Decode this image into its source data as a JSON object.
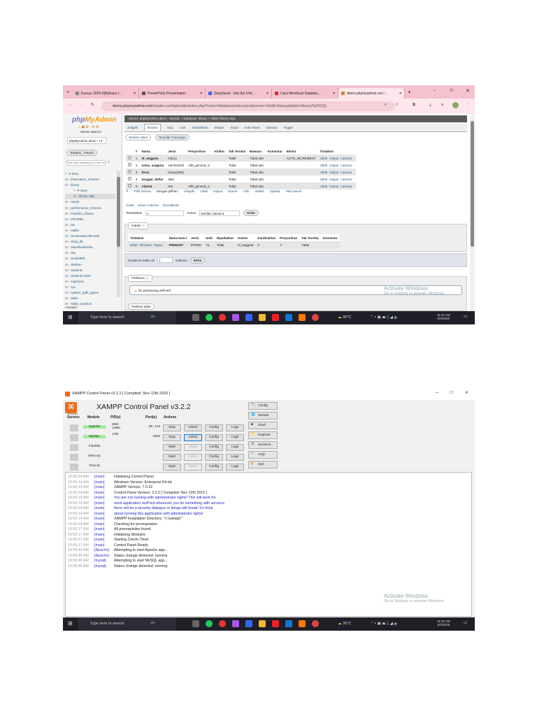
{
  "browser": {
    "tabs": [
      {
        "label": "Kursus 2024-2(Bahasa I..."
      },
      {
        "label": "PowerPoint Presentation"
      },
      {
        "label": "DeepSeek - Into the Unk..."
      },
      {
        "label": "Cara Membuat Databas..."
      },
      {
        "label": "demo.phpmyadmin.net /..."
      }
    ],
    "url_host": "demo.phpmyadmin.net",
    "url_path": "/master-config/public/index.php?route=/database/structure&server=2&db=library&table=library%20SQL"
  },
  "pma": {
    "logo": "phpMyAdmin",
    "server_label": "Server saat ini:",
    "server_select": "phpMyAdmin demo - I",
    "recent": "Terbaru",
    "favorites": "Favorit",
    "filter_placeholder": "Tulis untuk menyaring ini, Enter untuk...",
    "tree": [
      "Baru",
      "information_schema",
      "library",
      "Baru",
      "library SQL",
      "mysql",
      "performance_schema",
      "Portfolio_Irfansa",
      "PRUEBA",
      "pw",
      "sakila",
      "serverwebcollensula",
      "shop_db",
      "siteoflinedirekta",
      "sku",
      "SocketDB",
      "Stefano",
      "students",
      "students 2020",
      "superpos",
      "sys",
      "system_ipdb_igame",
      "table",
      "Table_insertion"
    ],
    "console": "Konsol",
    "breadcrumb": "Server: phpMyAdmin demo - MySQL  »  Database: library  »  Tabel: library SQL",
    "tabs": [
      "Jelajahi",
      "Struktur",
      "SQL",
      "Cari",
      "Tambahkan",
      "Ekspor",
      "Impor",
      "Hak Akses",
      "Operasi",
      "Trigger"
    ],
    "subtabs": [
      "Struktur tabel",
      "Tampilan hubungan"
    ],
    "columns": [
      "#",
      "Nama",
      "Jenis",
      "Penyortiran",
      "Atribut",
      "Tak Ternilai",
      "Bawaan",
      "Komentar",
      "Ekstra",
      "Tindakan"
    ],
    "rows": [
      [
        "1",
        "id_anggota",
        "int(11)",
        "",
        "",
        "Tidak",
        "Tidak ada",
        "",
        "AUTO_INCREMENT"
      ],
      [
        "2",
        "nama_anggota",
        "varchar(50)",
        "utf8_general_ci",
        "",
        "Tidak",
        "Tidak ada",
        "",
        ""
      ],
      [
        "3",
        "dona",
        "binary(280)",
        "",
        "",
        "Tidak",
        "Tidak ada",
        "",
        ""
      ],
      [
        "4",
        "tanggal_daftar",
        "date",
        "",
        "",
        "Tidak",
        "Tidak ada",
        "",
        ""
      ],
      [
        "5",
        "Alamat",
        "text",
        "utf8_general_ci",
        "",
        "Tidak",
        "Tidak ada",
        "",
        ""
      ]
    ],
    "row_actions": [
      "Ubah",
      "Hapus",
      "Lainnya"
    ],
    "bulk": [
      "Pilih Semua",
      "Dengan pilihan:",
      "Jelajahi",
      "Ubah",
      "Hapus",
      "Utama",
      "Unik",
      "Indeks",
      "Spasial",
      "Teks penuh"
    ],
    "tools": [
      "Cetak",
      "Move columns",
      "Normalisasi"
    ],
    "add_label": "Tambahkan",
    "add_value": "1",
    "add_cols": "kolom",
    "add_after": "setelah Alamat",
    "submit": "Kirim",
    "index_legend": "Indeks",
    "index_columns": [
      "Tindakan",
      "Nama kunci",
      "Jenis",
      "Unik",
      "Dipadatkan",
      "Kolom",
      "Kardinalitas",
      "Penyortiran",
      "Tak Ternilai",
      "Komentar"
    ],
    "index_row": {
      "actions": [
        "Ubah",
        "Rename",
        "Hapus"
      ],
      "values": [
        "PRIMARY",
        "BTREE",
        "Ya",
        "Tidak",
        "id_anggota",
        "0",
        "A",
        "Tidak",
        ""
      ]
    },
    "create_index": "Create an index on",
    "create_index_value": "1",
    "create_index_cols": "columns",
    "partitions_legend": "Partitions",
    "no_partition": "No partitioning defined!",
    "partition_table": "Partition table"
  },
  "watermark": {
    "title": "Activate Windows",
    "sub": "Go to Settings to activate Windows."
  },
  "taskbar1": {
    "search": "Type here to search",
    "weather": "30°C",
    "time": "11:33 AM",
    "date": "6/3/2025"
  },
  "taskbar2": {
    "search": "Type here to search",
    "weather": "30°C",
    "time": "11:35 AM",
    "date": "6/3/2025"
  },
  "xampp": {
    "window_title": "XAMPP Control Panel v3.2.2   [ Compiled: Nov 12th 2015 ]",
    "title": "XAMPP Control Panel v3.2.2",
    "modules_label": "Modules",
    "headers": [
      "Service",
      "Module",
      "PID(s)",
      "Port(s)",
      "Actions"
    ],
    "modules": [
      {
        "name": "Apache",
        "pid": "3860\n12984",
        "ports": "80, 443",
        "start": "Stop",
        "admin": "Admin",
        "config": "Config",
        "logs": "Logs",
        "running": true,
        "admin_enabled": true
      },
      {
        "name": "MySQL",
        "pid": "1784",
        "ports": "3306",
        "start": "Stop",
        "admin": "Admin",
        "config": "Config",
        "logs": "Logs",
        "running": true,
        "admin_enabled": true
      },
      {
        "name": "FileZilla",
        "pid": "",
        "ports": "",
        "start": "Start",
        "admin": "Admin",
        "config": "Config",
        "logs": "Logs",
        "running": false,
        "admin_enabled": false
      },
      {
        "name": "Mercury",
        "pid": "",
        "ports": "",
        "start": "Start",
        "admin": "Admin",
        "config": "Config",
        "logs": "Logs",
        "running": false,
        "admin_enabled": false
      },
      {
        "name": "Tomcat",
        "pid": "",
        "ports": "",
        "start": "Start",
        "admin": "Admin",
        "config": "Config",
        "logs": "Logs",
        "running": false,
        "admin_enabled": false
      }
    ],
    "side_buttons": [
      "Config",
      "Netstat",
      "Shell",
      "Explorer",
      "Services",
      "Help",
      "Quit"
    ],
    "log": [
      [
        "10:59:14 AM",
        "[main]",
        "Initializing Control Panel",
        false
      ],
      [
        "10:59:14 AM",
        "[main]",
        "Windows Version:  Enterprise  64-bit",
        false
      ],
      [
        "10:59:14 AM",
        "[main]",
        "XAMPP Version: 7.0.32",
        false
      ],
      [
        "10:59:14 AM",
        "[main]",
        "Control Panel Version: 3.2.2  [ Compiled: Nov 12th 2015 ]",
        false
      ],
      [
        "10:59:14 AM",
        "[main]",
        "You are not running with administrator rights! This will work for",
        true
      ],
      [
        "10:59:14 AM",
        "[main]",
        "most application stuff but whenever you do something with services",
        true
      ],
      [
        "10:59:14 AM",
        "[main]",
        "there will be a security dialogue or things will break! So think",
        true
      ],
      [
        "10:59:14 AM",
        "[main]",
        "about running this application with administrator rights!",
        true
      ],
      [
        "10:59:14 AM",
        "[main]",
        "XAMPP Installation Directory: \"c:\\xampp\\\"",
        false
      ],
      [
        "10:59:14 AM",
        "[main]",
        "Checking for prerequisites",
        false
      ],
      [
        "10:59:17 AM",
        "[main]",
        "All prerequisites found",
        false
      ],
      [
        "10:59:17 AM",
        "[main]",
        "Initializing Modules",
        false
      ],
      [
        "10:59:17 AM",
        "[main]",
        "Starting Check-Timer",
        false
      ],
      [
        "10:59:17 AM",
        "[main]",
        "Control Panel Ready",
        false
      ],
      [
        "10:59:44 AM",
        "[Apache]",
        "Attempting to start Apache app...",
        false
      ],
      [
        "10:59:44 AM",
        "[Apache]",
        "Status change detected: running",
        false
      ],
      [
        "10:59:45 AM",
        "[mysql]",
        "Attempting to start MySQL app...",
        false
      ],
      [
        "10:59:45 AM",
        "[mysql]",
        "Status change detected: running",
        false
      ]
    ]
  }
}
